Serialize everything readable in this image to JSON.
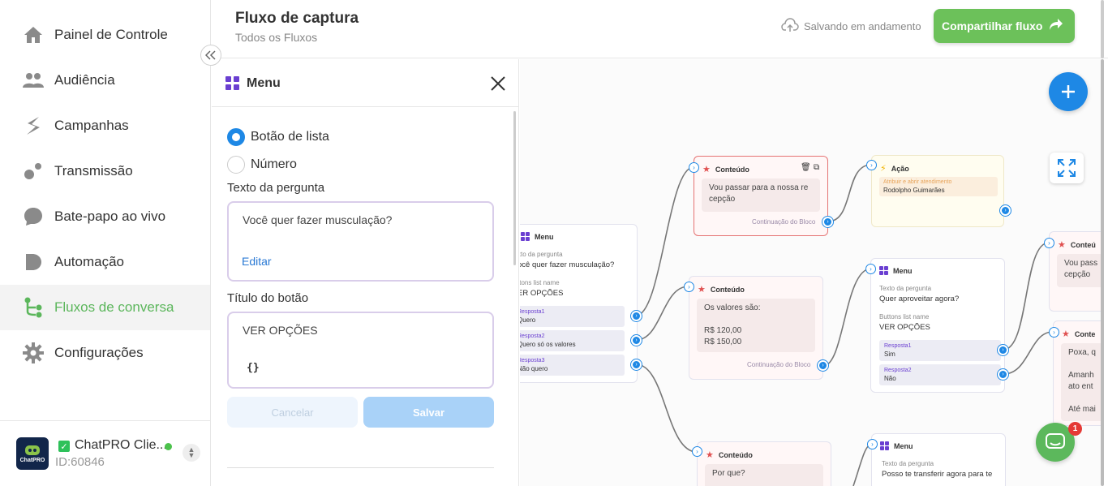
{
  "sidebar": {
    "items": [
      {
        "label": "Painel de Controle",
        "icon": "home-icon"
      },
      {
        "label": "Audiência",
        "icon": "users-icon"
      },
      {
        "label": "Campanhas",
        "icon": "campaign-icon"
      },
      {
        "label": "Transmissão",
        "icon": "broadcast-icon"
      },
      {
        "label": "Bate-papo ao vivo",
        "icon": "chat-bubble-icon"
      },
      {
        "label": "Automação",
        "icon": "automation-icon"
      },
      {
        "label": "Fluxos de conversa",
        "icon": "flow-icon"
      },
      {
        "label": "Configurações",
        "icon": "gear-icon"
      }
    ],
    "active_index": 6,
    "account": {
      "logo_text": "ChatPRO",
      "name": "ChatPRO Clie...",
      "id": "ID:60846"
    }
  },
  "header": {
    "title": "Fluxo de captura",
    "breadcrumb": "Todos os Fluxos",
    "save_status": "Salvando em andamento",
    "share_button": "Compartilhar fluxo"
  },
  "panel": {
    "title": "Menu",
    "radio_options": [
      {
        "label": "Botão de lista",
        "selected": true
      },
      {
        "label": "Número",
        "selected": false
      }
    ],
    "question_label": "Texto da pergunta",
    "question_value": "Você quer fazer musculação?",
    "edit_link": "Editar",
    "button_title_label": "Título do botão",
    "button_title_value": "VER OPÇÕES",
    "variable_icon": "{}",
    "cancel_button": "Cancelar",
    "save_button": "Salvar"
  },
  "canvas": {
    "nodes": {
      "menu1": {
        "title": "Menu",
        "q_label": "xto da pergunta",
        "q_value": "ocê quer fazer musculação?",
        "b_label": "ttons list name",
        "b_value": "ER OPÇÕES",
        "responses": [
          {
            "label": "Resposta1",
            "value": "Quero"
          },
          {
            "label": "Resposta2",
            "value": "Quero só os valores"
          },
          {
            "label": "Resposta3",
            "value": "Não quero"
          }
        ]
      },
      "content1": {
        "title": "Conteúdo",
        "body": "Vou passar para a nossa re cepção",
        "cont": "Continuação do Bloco"
      },
      "action1": {
        "title": "Ação",
        "tag_label": "Atribuir e abrir atendimento",
        "tag_value": "Rodolpho Guimarães"
      },
      "content2": {
        "title": "Conteúdo",
        "body_lines": [
          "Os valores são:",
          "",
          "R$ 120,00",
          "R$ 150,00"
        ],
        "cont": "Continuação do Bloco"
      },
      "menu2": {
        "title": "Menu",
        "q_label": "Texto da pergunta",
        "q_value": "Quer aproveitar agora?",
        "b_label": "Buttons list name",
        "b_value": "VER OPÇÕES",
        "responses": [
          {
            "label": "Resposta1",
            "value": "Sim"
          },
          {
            "label": "Resposta2",
            "value": "Não"
          }
        ]
      },
      "content3": {
        "title": "Conteú",
        "body": "Vou pass cepção"
      },
      "content4": {
        "title": "Conte",
        "body_lines": [
          "Poxa, q",
          "",
          "Amanh",
          "ato ent",
          "",
          "Até mai"
        ]
      },
      "content5": {
        "title": "Conteúdo",
        "body": "Por que?"
      },
      "menu3": {
        "title": "Menu",
        "q_label": "Texto da pergunta",
        "q_value": "Posso te transferir agora para te"
      }
    },
    "chat_badge": "1"
  },
  "colors": {
    "accent_green": "#6cc15a",
    "primary_blue": "#1e88e5",
    "menu_purple": "#6a3fd1",
    "content_red": "#e05050"
  }
}
